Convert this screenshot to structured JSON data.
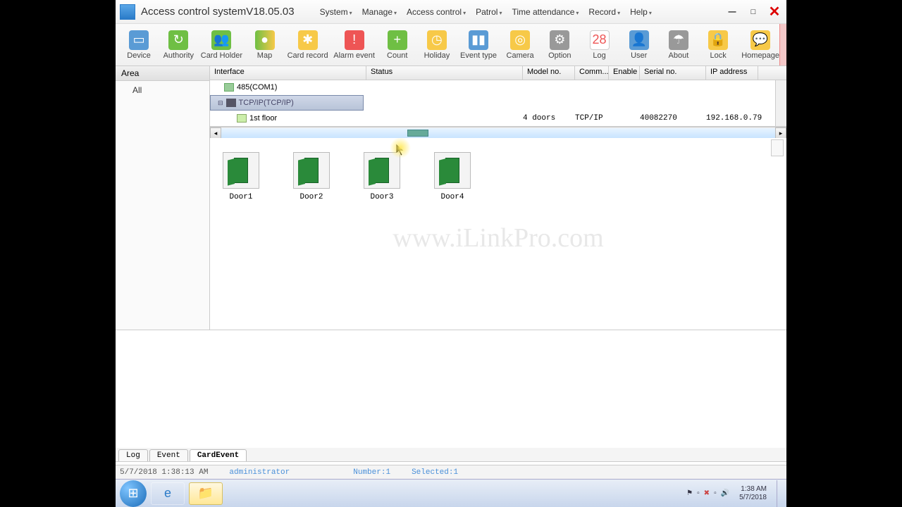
{
  "window": {
    "title": "Access control systemV18.05.03"
  },
  "menus": [
    "System",
    "Manage",
    "Access control",
    "Patrol",
    "Time attendance",
    "Record",
    "Help"
  ],
  "toolbar": [
    {
      "label": "Device",
      "icon": "device"
    },
    {
      "label": "Authority",
      "icon": "auth"
    },
    {
      "label": "Card Holder",
      "icon": "card"
    },
    {
      "label": "Map",
      "icon": "map"
    },
    {
      "label": "Card record",
      "icon": "record"
    },
    {
      "label": "Alarm event",
      "icon": "alarm"
    },
    {
      "label": "Count",
      "icon": "count"
    },
    {
      "label": "Holiday",
      "icon": "holiday"
    },
    {
      "label": "Event type",
      "icon": "event"
    },
    {
      "label": "Camera",
      "icon": "camera"
    },
    {
      "label": "Option",
      "icon": "option"
    },
    {
      "label": "Log",
      "icon": "log"
    },
    {
      "label": "User",
      "icon": "user"
    },
    {
      "label": "About",
      "icon": "about"
    },
    {
      "label": "Lock",
      "icon": "lock"
    },
    {
      "label": "Homepage",
      "icon": "home"
    }
  ],
  "sidebar": {
    "header": "Area",
    "root": "All"
  },
  "grid": {
    "columns": [
      "Interface",
      "Status",
      "Model no.",
      "Comm...",
      "Enable",
      "Serial no.",
      "IP address"
    ],
    "widths": [
      222,
      222,
      74,
      48,
      44,
      94,
      74
    ],
    "row485": "485(COM1)",
    "rowTcp": "TCP/IP(TCP/IP)",
    "rowFloor": {
      "name": "1st floor",
      "model": "4 doors",
      "comm": "TCP/IP",
      "enable": "",
      "serial": "40082270",
      "ip": "192.168.0.79"
    }
  },
  "doors": [
    "Door1",
    "Door2",
    "Door3",
    "Door4"
  ],
  "watermark": "www.iLinkPro.com",
  "bottomTabs": [
    "Log",
    "Event",
    "CardEvent"
  ],
  "status": {
    "datetime": "5/7/2018 1:38:13 AM",
    "user": "administrator",
    "number": "Number:1",
    "selected": "Selected:1"
  },
  "taskbar": {
    "time": "1:38 AM",
    "date": "5/7/2018"
  }
}
